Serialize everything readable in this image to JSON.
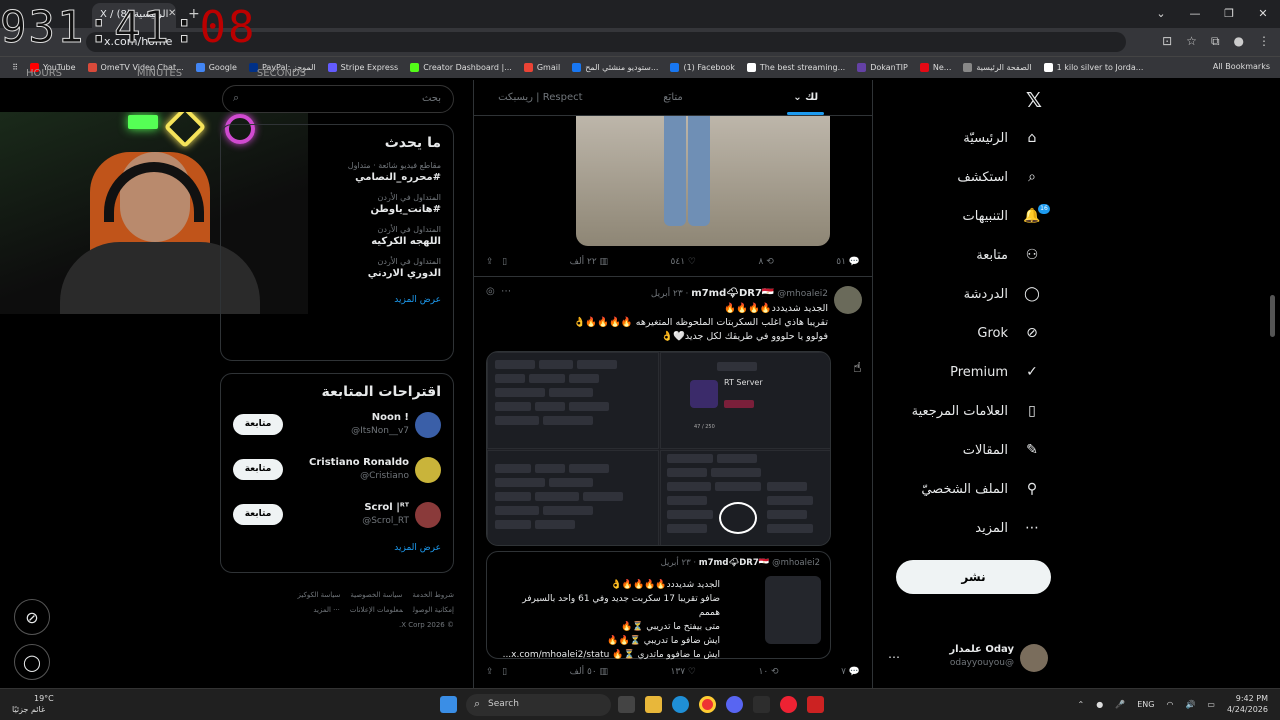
{
  "browser": {
    "tab_title": "X / الرئيسية (8)",
    "url": "x.com/home",
    "bookmarks": [
      {
        "label": "YouTube",
        "color": "#ff0000"
      },
      {
        "label": "OmeTV Video Chat...",
        "color": "#d94a3a"
      },
      {
        "label": "Google",
        "color": "#4285f4"
      },
      {
        "label": "PayPal: الموجز",
        "color": "#003087"
      },
      {
        "label": "Stripe Express",
        "color": "#635bff"
      },
      {
        "label": "Creator Dashboard |...",
        "color": "#53fc18"
      },
      {
        "label": "Gmail",
        "color": "#ea4335"
      },
      {
        "label": "ستوديو منشئي المح...",
        "color": "#1877f2"
      },
      {
        "label": "(1) Facebook",
        "color": "#1877f2"
      },
      {
        "label": "The best streaming...",
        "color": "#ffffff"
      },
      {
        "label": "DokanTIP",
        "color": "#6441a5"
      },
      {
        "label": "Ne...",
        "color": "#e50914"
      },
      {
        "label": "الصفحة الرئيسية",
        "color": "#888888"
      },
      {
        "label": "1 kilo silver to Jorda...",
        "color": "#ffffff"
      }
    ],
    "all_bookmarks": "All Bookmarks"
  },
  "timer": {
    "hours": "931",
    "minutes": "41",
    "seconds": "08",
    "labels": [
      "HOURS",
      "MINUTES",
      "SECONDS"
    ]
  },
  "search": {
    "placeholder": "بحث"
  },
  "trends": {
    "title": "ما يحدث",
    "items": [
      {
        "context": "مقاطع فيديو شائعة · متداول",
        "topic": "#محرره_النصامي"
      },
      {
        "context": "المتداول في الأردن",
        "topic": "#هانت_ياوطن"
      },
      {
        "context": "المتداول في الأردن",
        "topic": "اللهجه الكركيه"
      },
      {
        "context": "المتداول في الأردن",
        "topic": "الدوري الاردني"
      }
    ],
    "show_more": "عرض المزيد"
  },
  "who_to_follow": {
    "title": "اقتراحات المتابعة",
    "accounts": [
      {
        "name": "! Noon",
        "handle": "@ItsNon__v7",
        "button": "متابعة",
        "avatar_color": "#3a5fa8"
      },
      {
        "name": "Cristiano Ronaldo",
        "handle": "@Cristiano",
        "button": "متابعة",
        "avatar_color": "#c9b43a"
      },
      {
        "name": "Scrol |ᴿᵀ",
        "handle": "@Scrol_RT",
        "button": "متابعة",
        "avatar_color": "#8a3a3a"
      }
    ],
    "show_more": "عرض المزيد"
  },
  "footer": {
    "links": [
      "شروط الخدمة",
      "سياسة الخصوصية",
      "سياسة الكوكيز",
      "إمكانية الوصول",
      "معلومات الإعلانات",
      "··· المزيد"
    ],
    "copyright": "© 2026 X Corp."
  },
  "feed": {
    "tabs": [
      "لك",
      "متابَع",
      "Respect | ريسبكت"
    ],
    "post1_actions": {
      "replies": "٥١",
      "reposts": "٨",
      "likes": "٥٤١",
      "views": "٢٢ ألف"
    },
    "post2": {
      "name": "m7md🌩DR7🇪🇬",
      "handle": "@mhoalei2",
      "date": "٢٣ أبريل",
      "lines": [
        "الجديد شديددد🔥🔥🔥🔥",
        "تقريبا هاذي اغلب السكربتات الملحوظه المتغيرهه 🔥🔥🔥🔥👌",
        "فولوو يا حلووو في طريقك لكل جديد🤍👌"
      ],
      "image": {
        "rt_server": "RT Server",
        "rt_members": "47 / 250"
      }
    },
    "quote": {
      "name": "m7md🌩DR7🇪🇬",
      "handle": "@mhoalei2",
      "date": "٢٣ أبريل",
      "lines": [
        "الجديد شديددد🔥🔥🔥🔥👌",
        "ضافو تقريبا 17 سكربت جديد وفي 61 واحد بالسيرفر هممم",
        "متى بيفتح ما تدريبي ⏳🔥",
        "ايش ضافو ما تدريبي ⏳🔥🔥",
        "ايش ما ضافوو ماتدري ⏳🔥 x.com/mhoalei2/statu..."
      ]
    },
    "post2_actions": {
      "replies": "٧",
      "reposts": "١٠",
      "likes": "١٣٧",
      "views": "٥٠ ألف"
    }
  },
  "nav": {
    "items": [
      {
        "label": "الرئيسيّة",
        "icon": "home-icon",
        "glyph": "⌂"
      },
      {
        "label": "استكشف",
        "icon": "search-icon",
        "glyph": "⌕"
      },
      {
        "label": "التنبيهات",
        "icon": "bell-icon",
        "glyph": "🔔",
        "badge": "16"
      },
      {
        "label": "متابعة",
        "icon": "add-person-icon",
        "glyph": "⚇"
      },
      {
        "label": "الدردشة",
        "icon": "chat-icon",
        "glyph": "◯"
      },
      {
        "label": "Grok",
        "icon": "grok-icon",
        "glyph": "⊘"
      },
      {
        "label": "Premium",
        "icon": "premium-icon",
        "glyph": "✓"
      },
      {
        "label": "العلامات المرجعية",
        "icon": "bookmark-icon",
        "glyph": "▯"
      },
      {
        "label": "المقالات",
        "icon": "article-icon",
        "glyph": "✎"
      },
      {
        "label": "الملف الشخصيّ",
        "icon": "profile-icon",
        "glyph": "⚲"
      },
      {
        "label": "المزيد",
        "icon": "more-icon",
        "glyph": "⋯"
      }
    ],
    "post_button": "نشر",
    "account": {
      "name": "Oday علمدار",
      "handle": "@odayyouyou"
    }
  },
  "taskbar": {
    "temp": "19°C",
    "weather": "غائم جزئيًا",
    "search": "Search",
    "lang": "ENG",
    "time": "9:42 PM",
    "date": "4/24/2026"
  }
}
